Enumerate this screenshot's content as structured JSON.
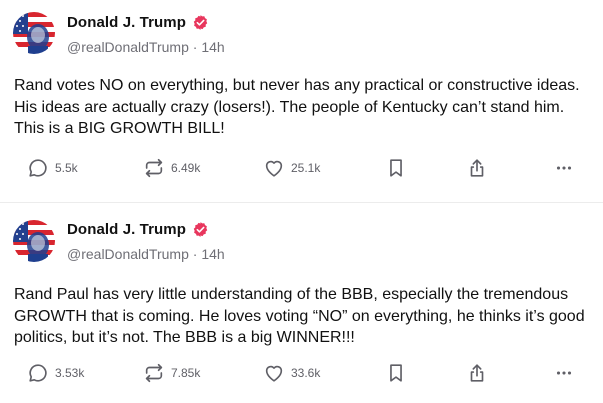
{
  "posts": [
    {
      "author": "Donald J. Trump",
      "handle": "@realDonaldTrump",
      "time": "14h",
      "separator": "·",
      "text": "Rand votes NO on everything, but never has any practical or constructive ideas. His ideas are actually crazy (losers!). The people of Kentucky can’t stand him. This is a BIG GROWTH BILL!",
      "replies": "5.5k",
      "reposts": "6.49k",
      "likes": "25.1k"
    },
    {
      "author": "Donald J. Trump",
      "handle": "@realDonaldTrump",
      "time": "14h",
      "separator": "·",
      "text": "Rand Paul has very little understanding of the BBB, especially the tremendous GROWTH that is coming. He loves voting “NO” on everything, he thinks it’s good politics, but it’s not. The BBB is a big WINNER!!!",
      "replies": "3.53k",
      "reposts": "7.85k",
      "likes": "33.6k"
    }
  ],
  "colors": {
    "verified_badge": "#e8365d",
    "text_primary": "#111111",
    "text_muted": "#6f6f76",
    "icon": "#5f5f66",
    "divider": "#ececec"
  },
  "icons": {
    "verified": "verified-badge-icon",
    "reply": "reply-icon",
    "repost": "repost-icon",
    "like": "heart-icon",
    "bookmark": "bookmark-icon",
    "share": "share-icon",
    "more": "more-icon"
  }
}
